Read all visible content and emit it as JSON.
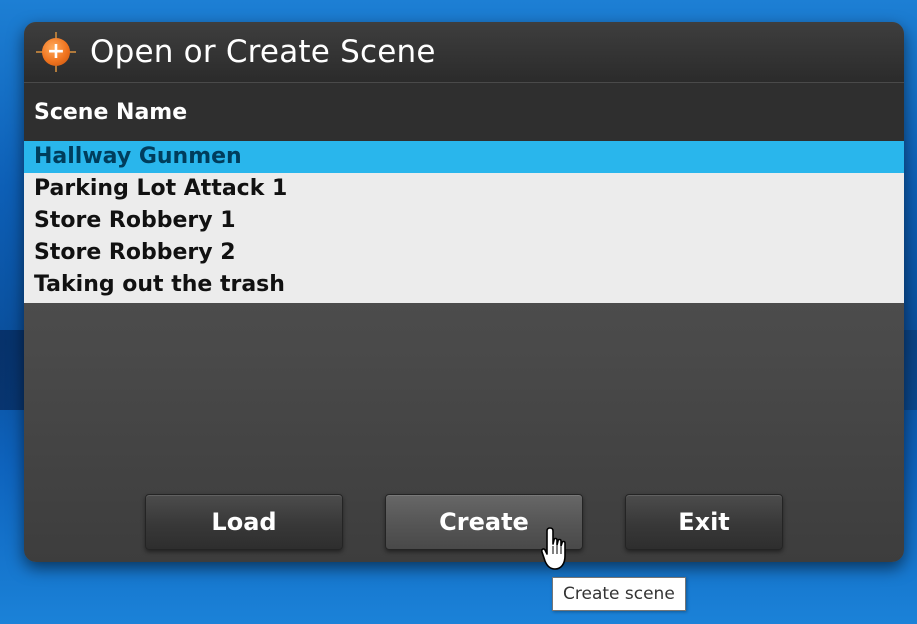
{
  "dialog": {
    "title": "Open or Create Scene",
    "icon": "plus-crosshair-icon"
  },
  "list": {
    "header": "Scene Name",
    "items": [
      {
        "label": "Hallway Gunmen",
        "selected": true
      },
      {
        "label": "Parking Lot Attack 1",
        "selected": false
      },
      {
        "label": "Store Robbery 1",
        "selected": false
      },
      {
        "label": "Store Robbery 2",
        "selected": false
      },
      {
        "label": "Taking out the trash",
        "selected": false
      }
    ]
  },
  "buttons": {
    "load": "Load",
    "create": "Create",
    "exit": "Exit"
  },
  "tooltip": {
    "text": "Create scene"
  },
  "colors": {
    "selection": "#29b6ec",
    "accent_icon": "#f0741f"
  }
}
